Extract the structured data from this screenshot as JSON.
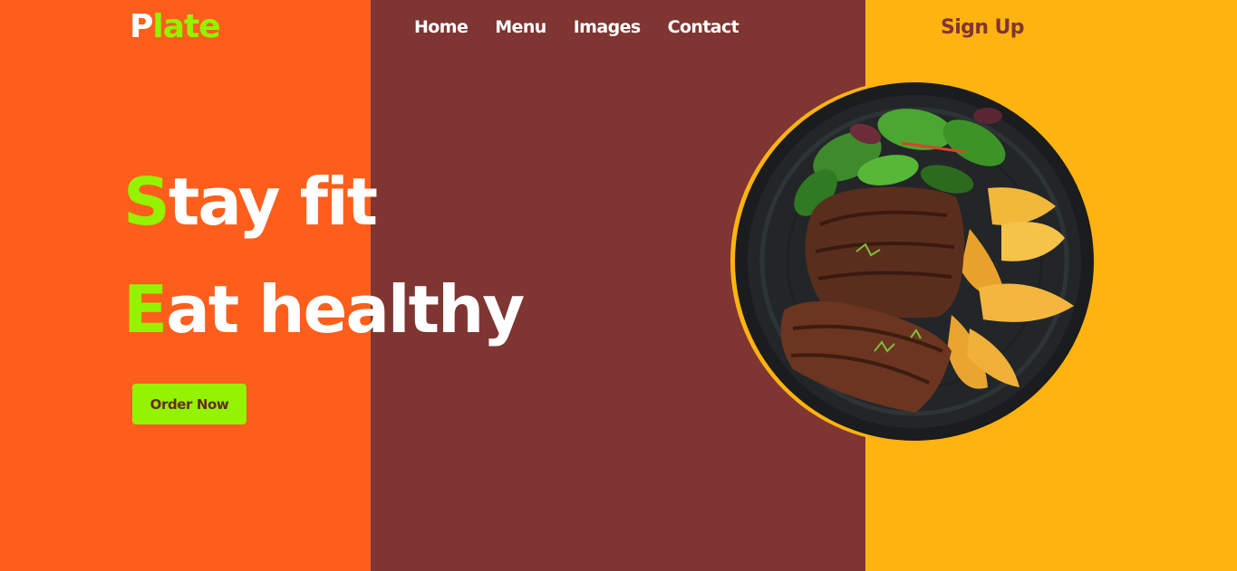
{
  "brand": {
    "first_letter": "P",
    "rest": "late"
  },
  "nav": {
    "items": [
      "Home",
      "Menu",
      "Images",
      "Contact"
    ]
  },
  "signup_label": "Sign Up",
  "hero": {
    "line1_first": "S",
    "line1_rest": "tay fit",
    "line2_first": "E",
    "line2_rest": "at healthy"
  },
  "cta_label": "Order Now",
  "image": {
    "subject": "grilled-steak-with-salad-and-potato-wedges-on-dark-plate"
  },
  "colors": {
    "orange": "#fe5e1b",
    "maroon": "#7f3532",
    "yellow": "#ffb310",
    "accent_green": "#94f300",
    "button_text": "#6b2a22",
    "signup_text": "#7f3532"
  }
}
